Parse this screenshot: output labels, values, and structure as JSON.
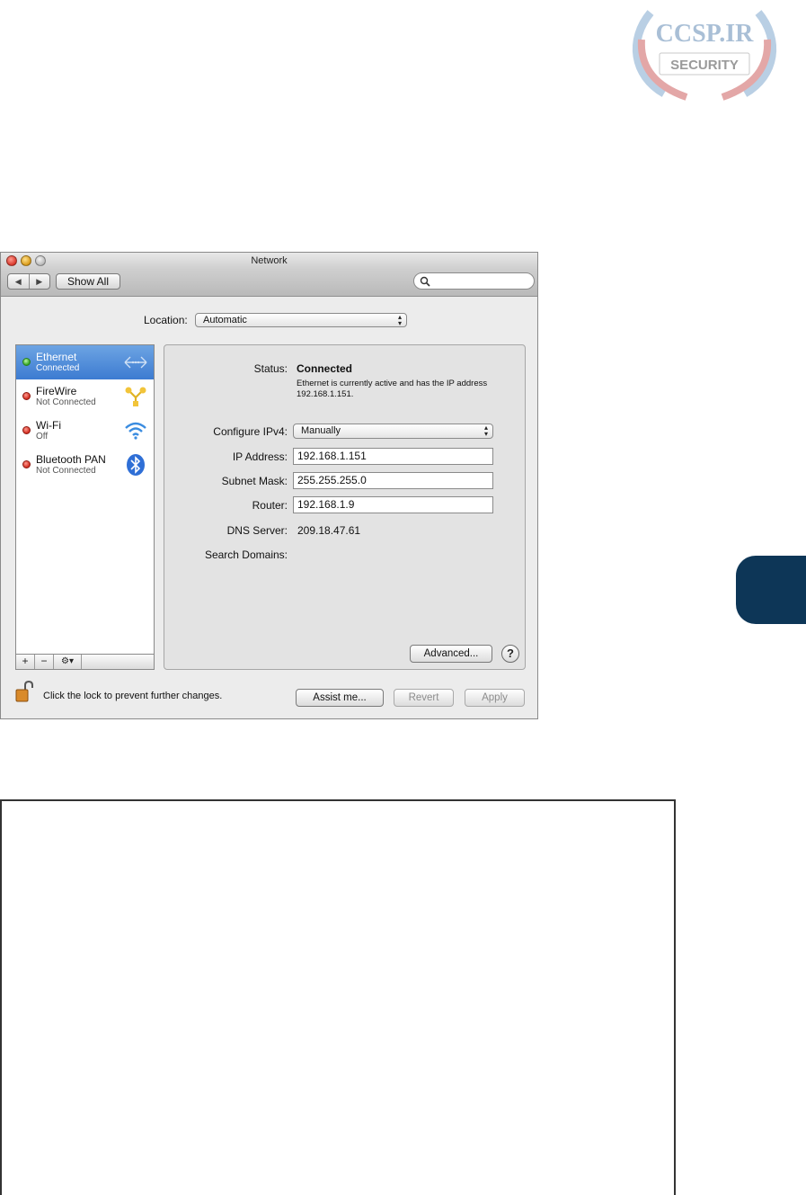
{
  "watermark": {
    "brand": "CCSP.IR",
    "sub": "SECURITY"
  },
  "window": {
    "title": "Network",
    "toolbar": {
      "back": "◀",
      "forward": "▶",
      "show_all": "Show All",
      "search_placeholder": ""
    }
  },
  "location": {
    "label": "Location:",
    "value": "Automatic"
  },
  "services": [
    {
      "name": "Ethernet",
      "status": "Connected",
      "indicator": "green",
      "icon": "ethernet-arrows-icon",
      "selected": true
    },
    {
      "name": "FireWire",
      "status": "Not Connected",
      "indicator": "red",
      "icon": "firewire-icon",
      "selected": false
    },
    {
      "name": "Wi-Fi",
      "status": "Off",
      "indicator": "red",
      "icon": "wifi-icon",
      "selected": false
    },
    {
      "name": "Bluetooth PAN",
      "status": "Not Connected",
      "indicator": "red",
      "icon": "bluetooth-icon",
      "selected": false
    }
  ],
  "sidebar_buttons": {
    "add": "+",
    "remove": "−",
    "action": "⚙▾"
  },
  "detail": {
    "status_label": "Status:",
    "status_value": "Connected",
    "status_desc": "Ethernet is currently active and has the IP address 192.168.1.151.",
    "configure_label": "Configure IPv4:",
    "configure_value": "Manually",
    "ip_label": "IP Address:",
    "ip_value": "192.168.1.151",
    "subnet_label": "Subnet Mask:",
    "subnet_value": "255.255.255.0",
    "router_label": "Router:",
    "router_value": "192.168.1.9",
    "dns_label": "DNS Server:",
    "dns_value": "209.18.47.61",
    "search_label": "Search Domains:",
    "advanced": "Advanced...",
    "help": "?"
  },
  "footer": {
    "lock_text": "Click the lock to prevent further changes.",
    "assist": "Assist me...",
    "revert": "Revert",
    "apply": "Apply"
  }
}
